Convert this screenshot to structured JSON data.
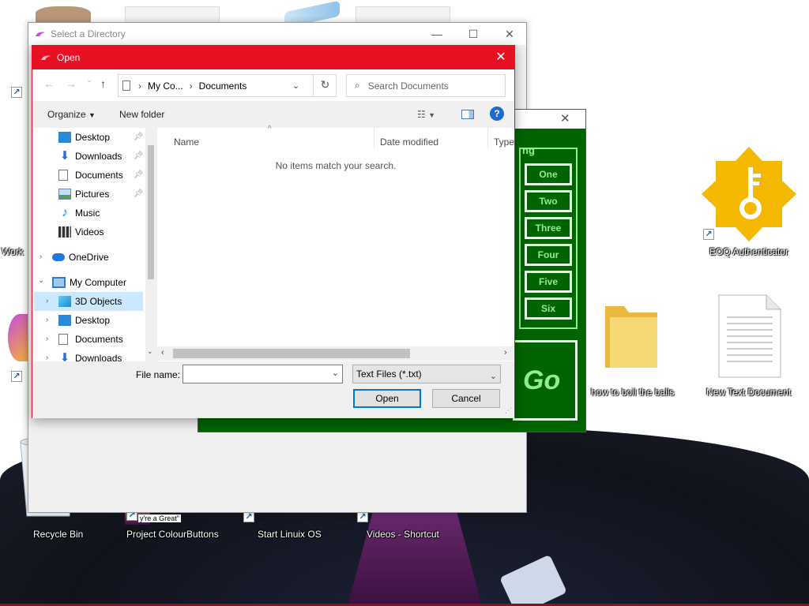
{
  "desktop": {
    "icons": [
      {
        "label": "Work"
      },
      {
        "label": "EOQ Authenticator"
      },
      {
        "label": "how to boil the balls"
      },
      {
        "label": "New Text Document"
      },
      {
        "label": "Recycle Bin"
      },
      {
        "label": "Project ColourButtons"
      },
      {
        "label": "Start Linuix OS"
      },
      {
        "label": "Videos - Shortcut"
      }
    ],
    "thumbnail_text": "y're a Great\""
  },
  "select_dir_window": {
    "title": "Select a Directory",
    "controls": {
      "minimize": "—",
      "maximize": "☐",
      "close": "✕"
    }
  },
  "green_app": {
    "panel_title": "ng",
    "buttons": [
      "One",
      "Two",
      "Three",
      "Four",
      "Five",
      "Six"
    ],
    "go_label": "Go",
    "close": "✕"
  },
  "open_dialog": {
    "title": "Open",
    "close": "✕",
    "nav": {
      "back": "←",
      "forward": "→",
      "recent": "⌄",
      "up": "↑",
      "refresh": "↻"
    },
    "breadcrumb": [
      "My Co...",
      "Documents"
    ],
    "search_placeholder": "Search Documents",
    "toolbar": {
      "organize": "Organize",
      "new_folder": "New folder",
      "help": "?"
    },
    "tree": [
      {
        "label": "Desktop",
        "pinned": true
      },
      {
        "label": "Downloads",
        "pinned": true
      },
      {
        "label": "Documents",
        "pinned": true
      },
      {
        "label": "Pictures",
        "pinned": true
      },
      {
        "label": "Music",
        "pinned": false
      },
      {
        "label": "Videos",
        "pinned": false
      },
      {
        "label": "OneDrive",
        "pinned": false
      },
      {
        "label": "My Computer",
        "pinned": false
      },
      {
        "label": "3D Objects",
        "pinned": false,
        "selected": true
      },
      {
        "label": "Desktop",
        "pinned": false
      },
      {
        "label": "Documents",
        "pinned": false
      },
      {
        "label": "Downloads",
        "pinned": false
      }
    ],
    "columns": [
      "Name",
      "Date modified",
      "Type"
    ],
    "empty_message": "No items match your search.",
    "file_name_label": "File name:",
    "file_name_value": "",
    "file_type": "Text Files (*.txt)",
    "open_button": "Open",
    "cancel_button": "Cancel"
  },
  "colors": {
    "title_red": "#e81123",
    "green_bg": "#006400",
    "green_text": "#90ee90",
    "selection": "#cce8ff",
    "accent_blue": "#0078d7"
  }
}
